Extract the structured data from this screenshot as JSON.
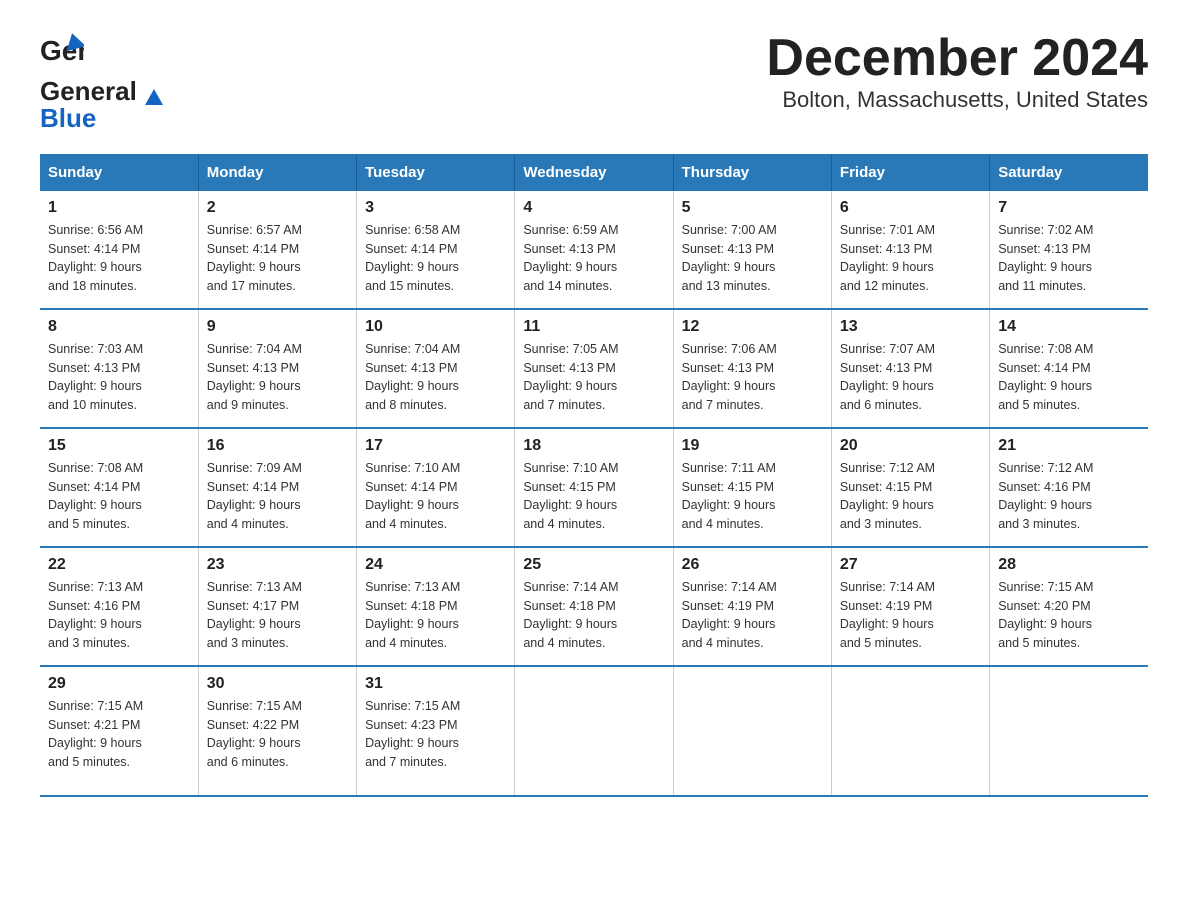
{
  "logo": {
    "general": "General",
    "blue": "Blue"
  },
  "title": "December 2024",
  "subtitle": "Bolton, Massachusetts, United States",
  "weekdays": [
    "Sunday",
    "Monday",
    "Tuesday",
    "Wednesday",
    "Thursday",
    "Friday",
    "Saturday"
  ],
  "weeks": [
    [
      {
        "day": "1",
        "sunrise": "6:56 AM",
        "sunset": "4:14 PM",
        "daylight": "9 hours and 18 minutes."
      },
      {
        "day": "2",
        "sunrise": "6:57 AM",
        "sunset": "4:14 PM",
        "daylight": "9 hours and 17 minutes."
      },
      {
        "day": "3",
        "sunrise": "6:58 AM",
        "sunset": "4:14 PM",
        "daylight": "9 hours and 15 minutes."
      },
      {
        "day": "4",
        "sunrise": "6:59 AM",
        "sunset": "4:13 PM",
        "daylight": "9 hours and 14 minutes."
      },
      {
        "day": "5",
        "sunrise": "7:00 AM",
        "sunset": "4:13 PM",
        "daylight": "9 hours and 13 minutes."
      },
      {
        "day": "6",
        "sunrise": "7:01 AM",
        "sunset": "4:13 PM",
        "daylight": "9 hours and 12 minutes."
      },
      {
        "day": "7",
        "sunrise": "7:02 AM",
        "sunset": "4:13 PM",
        "daylight": "9 hours and 11 minutes."
      }
    ],
    [
      {
        "day": "8",
        "sunrise": "7:03 AM",
        "sunset": "4:13 PM",
        "daylight": "9 hours and 10 minutes."
      },
      {
        "day": "9",
        "sunrise": "7:04 AM",
        "sunset": "4:13 PM",
        "daylight": "9 hours and 9 minutes."
      },
      {
        "day": "10",
        "sunrise": "7:04 AM",
        "sunset": "4:13 PM",
        "daylight": "9 hours and 8 minutes."
      },
      {
        "day": "11",
        "sunrise": "7:05 AM",
        "sunset": "4:13 PM",
        "daylight": "9 hours and 7 minutes."
      },
      {
        "day": "12",
        "sunrise": "7:06 AM",
        "sunset": "4:13 PM",
        "daylight": "9 hours and 7 minutes."
      },
      {
        "day": "13",
        "sunrise": "7:07 AM",
        "sunset": "4:13 PM",
        "daylight": "9 hours and 6 minutes."
      },
      {
        "day": "14",
        "sunrise": "7:08 AM",
        "sunset": "4:14 PM",
        "daylight": "9 hours and 5 minutes."
      }
    ],
    [
      {
        "day": "15",
        "sunrise": "7:08 AM",
        "sunset": "4:14 PM",
        "daylight": "9 hours and 5 minutes."
      },
      {
        "day": "16",
        "sunrise": "7:09 AM",
        "sunset": "4:14 PM",
        "daylight": "9 hours and 4 minutes."
      },
      {
        "day": "17",
        "sunrise": "7:10 AM",
        "sunset": "4:14 PM",
        "daylight": "9 hours and 4 minutes."
      },
      {
        "day": "18",
        "sunrise": "7:10 AM",
        "sunset": "4:15 PM",
        "daylight": "9 hours and 4 minutes."
      },
      {
        "day": "19",
        "sunrise": "7:11 AM",
        "sunset": "4:15 PM",
        "daylight": "9 hours and 4 minutes."
      },
      {
        "day": "20",
        "sunrise": "7:12 AM",
        "sunset": "4:15 PM",
        "daylight": "9 hours and 3 minutes."
      },
      {
        "day": "21",
        "sunrise": "7:12 AM",
        "sunset": "4:16 PM",
        "daylight": "9 hours and 3 minutes."
      }
    ],
    [
      {
        "day": "22",
        "sunrise": "7:13 AM",
        "sunset": "4:16 PM",
        "daylight": "9 hours and 3 minutes."
      },
      {
        "day": "23",
        "sunrise": "7:13 AM",
        "sunset": "4:17 PM",
        "daylight": "9 hours and 3 minutes."
      },
      {
        "day": "24",
        "sunrise": "7:13 AM",
        "sunset": "4:18 PM",
        "daylight": "9 hours and 4 minutes."
      },
      {
        "day": "25",
        "sunrise": "7:14 AM",
        "sunset": "4:18 PM",
        "daylight": "9 hours and 4 minutes."
      },
      {
        "day": "26",
        "sunrise": "7:14 AM",
        "sunset": "4:19 PM",
        "daylight": "9 hours and 4 minutes."
      },
      {
        "day": "27",
        "sunrise": "7:14 AM",
        "sunset": "4:19 PM",
        "daylight": "9 hours and 5 minutes."
      },
      {
        "day": "28",
        "sunrise": "7:15 AM",
        "sunset": "4:20 PM",
        "daylight": "9 hours and 5 minutes."
      }
    ],
    [
      {
        "day": "29",
        "sunrise": "7:15 AM",
        "sunset": "4:21 PM",
        "daylight": "9 hours and 5 minutes."
      },
      {
        "day": "30",
        "sunrise": "7:15 AM",
        "sunset": "4:22 PM",
        "daylight": "9 hours and 6 minutes."
      },
      {
        "day": "31",
        "sunrise": "7:15 AM",
        "sunset": "4:23 PM",
        "daylight": "9 hours and 7 minutes."
      },
      {
        "day": "",
        "sunrise": "",
        "sunset": "",
        "daylight": ""
      },
      {
        "day": "",
        "sunrise": "",
        "sunset": "",
        "daylight": ""
      },
      {
        "day": "",
        "sunrise": "",
        "sunset": "",
        "daylight": ""
      },
      {
        "day": "",
        "sunrise": "",
        "sunset": "",
        "daylight": ""
      }
    ]
  ],
  "labels": {
    "sunrise": "Sunrise: ",
    "sunset": "Sunset: ",
    "daylight": "Daylight: "
  },
  "colors": {
    "header_bg": "#2979b8",
    "border": "#2979b8"
  }
}
